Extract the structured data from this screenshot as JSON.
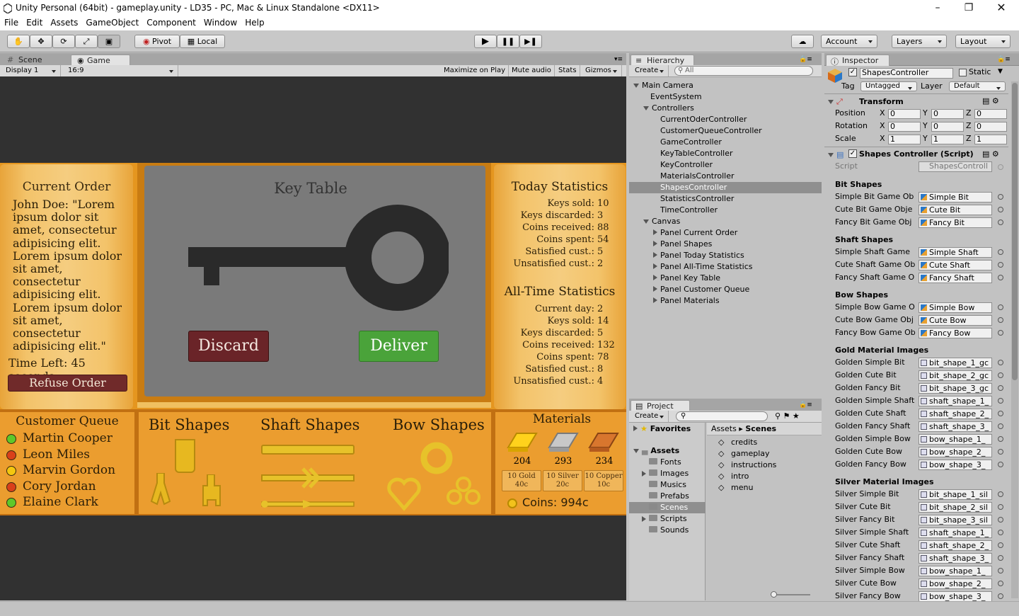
{
  "window": {
    "title": "Unity Personal (64bit) - gameplay.unity - LD35 - PC, Mac & Linux Standalone <DX11>"
  },
  "menu": [
    "File",
    "Edit",
    "Assets",
    "GameObject",
    "Component",
    "Window",
    "Help"
  ],
  "toolbar": {
    "pivot": "Pivot",
    "local": "Local",
    "account": "Account",
    "layers": "Layers",
    "layout": "Layout"
  },
  "tabs": {
    "scene": "Scene",
    "game": "Game",
    "hierarchy": "Hierarchy",
    "inspector": "Inspector",
    "project": "Project"
  },
  "gamebar": {
    "display": "Display 1",
    "aspect": "16:9",
    "maximize": "Maximize on Play",
    "mute": "Mute audio",
    "stats": "Stats",
    "gizmos": "Gizmos"
  },
  "game": {
    "current_order": {
      "title": "Current Order",
      "text": "John Doe: \"Lorem ipsum dolor sit amet, consectetur adipisicing elit. Lorem ipsum dolor sit amet, consectetur adipisicing elit. Lorem ipsum dolor sit amet, consectetur adipisicing elit.\"",
      "time_left": "Time Left: 45 seconds",
      "refuse": "Refuse Order"
    },
    "key_table": {
      "title": "Key Table",
      "discard": "Discard",
      "deliver": "Deliver"
    },
    "today": {
      "title": "Today Statistics",
      "rows": [
        [
          "Keys sold:",
          "10"
        ],
        [
          "Keys discarded:",
          "3"
        ],
        [
          "Coins received:",
          "88"
        ],
        [
          "Coins spent:",
          "54"
        ],
        [
          "Satisfied cust.:",
          "5"
        ],
        [
          "Unsatisfied cust.:",
          "2"
        ]
      ]
    },
    "alltime": {
      "title": "All-Time Statistics",
      "rows": [
        [
          "Current day:",
          "2"
        ],
        [
          "Keys sold:",
          "14"
        ],
        [
          "Keys discarded:",
          "5"
        ],
        [
          "Coins received:",
          "132"
        ],
        [
          "Coins spent:",
          "78"
        ],
        [
          "Satisfied cust.:",
          "8"
        ],
        [
          "Unsatisfied cust.:",
          "4"
        ]
      ]
    },
    "queue": {
      "title": "Customer Queue",
      "customers": [
        {
          "name": "Martin Cooper",
          "status": "#5ec82a"
        },
        {
          "name": "Leon Miles",
          "status": "#d9401a"
        },
        {
          "name": "Marvin Gordon",
          "status": "#f4c70f"
        },
        {
          "name": "Cory Jordan",
          "status": "#d9401a"
        },
        {
          "name": "Elaine Clark",
          "status": "#5ec82a"
        }
      ]
    },
    "shapes": {
      "bit": "Bit Shapes",
      "shaft": "Shaft Shapes",
      "bow": "Bow Shapes"
    },
    "materials": {
      "title": "Materials",
      "counts": [
        "204",
        "293",
        "234"
      ],
      "buy": [
        [
          "10 Gold",
          "40c"
        ],
        [
          "10 Silver",
          "20c"
        ],
        [
          "10 Copper",
          "10c"
        ]
      ],
      "coins": "Coins: 994c"
    }
  },
  "hierarchy": {
    "create": "Create",
    "search_placeholder": "All",
    "items": [
      {
        "label": "Main Camera",
        "depth": 0,
        "arrow": "open"
      },
      {
        "label": "EventSystem",
        "depth": 1,
        "arrow": "none"
      },
      {
        "label": "Controllers",
        "depth": 1,
        "arrow": "open"
      },
      {
        "label": "CurrentOderController",
        "depth": 2,
        "arrow": "none"
      },
      {
        "label": "CustomerQueueController",
        "depth": 2,
        "arrow": "none"
      },
      {
        "label": "GameController",
        "depth": 2,
        "arrow": "none"
      },
      {
        "label": "KeyTableController",
        "depth": 2,
        "arrow": "none"
      },
      {
        "label": "KeyController",
        "depth": 2,
        "arrow": "none"
      },
      {
        "label": "MaterialsController",
        "depth": 2,
        "arrow": "none"
      },
      {
        "label": "ShapesController",
        "depth": 2,
        "arrow": "none",
        "selected": true
      },
      {
        "label": "StatisticsController",
        "depth": 2,
        "arrow": "none"
      },
      {
        "label": "TimeController",
        "depth": 2,
        "arrow": "none"
      },
      {
        "label": "Canvas",
        "depth": 1,
        "arrow": "open"
      },
      {
        "label": "Panel Current Order",
        "depth": 2,
        "arrow": "closed"
      },
      {
        "label": "Panel Shapes",
        "depth": 2,
        "arrow": "closed"
      },
      {
        "label": "Panel Today Statistics",
        "depth": 2,
        "arrow": "closed"
      },
      {
        "label": "Panel All-Time Statistics",
        "depth": 2,
        "arrow": "closed"
      },
      {
        "label": "Panel Key Table",
        "depth": 2,
        "arrow": "closed"
      },
      {
        "label": "Panel Customer Queue",
        "depth": 2,
        "arrow": "closed"
      },
      {
        "label": "Panel Materials",
        "depth": 2,
        "arrow": "closed"
      }
    ]
  },
  "project": {
    "create": "Create",
    "favorites": "Favorites",
    "assets": "Assets",
    "folders": [
      "Fonts",
      "Images",
      "Musics",
      "Prefabs",
      "Scenes",
      "Scripts",
      "Sounds"
    ],
    "breadcrumb": [
      "Assets",
      "Scenes"
    ],
    "scenes": [
      "credits",
      "gameplay",
      "instructions",
      "intro",
      "menu"
    ]
  },
  "inspector": {
    "object_name": "ShapesController",
    "static": "Static",
    "tag_label": "Tag",
    "tag": "Untagged",
    "layer_label": "Layer",
    "layer": "Default",
    "transform": {
      "title": "Transform",
      "rows": [
        [
          "Position",
          "0",
          "0",
          "0"
        ],
        [
          "Rotation",
          "0",
          "0",
          "0"
        ],
        [
          "Scale",
          "1",
          "1",
          "1"
        ]
      ]
    },
    "script_title": "Shapes Controller (Script)",
    "script_label": "Script",
    "script_value": "ShapesControll",
    "sections": [
      {
        "title": "Bit Shapes",
        "rows": [
          [
            "Simple Bit Game Ob",
            "Simple Bit"
          ],
          [
            "Cute Bit Game Obje",
            "Cute Bit"
          ],
          [
            "Fancy Bit Game Obj",
            "Fancy Bit"
          ]
        ]
      },
      {
        "title": "Shaft Shapes",
        "rows": [
          [
            "Simple Shaft Game",
            "Simple Shaft"
          ],
          [
            "Cute Shaft Game Ob",
            "Cute Shaft"
          ],
          [
            "Fancy Shaft Game O",
            "Fancy Shaft"
          ]
        ]
      },
      {
        "title": "Bow Shapes",
        "rows": [
          [
            "Simple Bow Game O",
            "Simple Bow"
          ],
          [
            "Cute Bow Game Obj",
            "Cute Bow"
          ],
          [
            "Fancy Bow Game Ob",
            "Fancy Bow"
          ]
        ]
      },
      {
        "title": "Gold Material Images",
        "rows": [
          [
            "Golden Simple Bit",
            "bit_shape_1_gc"
          ],
          [
            "Golden Cute Bit",
            "bit_shape_2_gc"
          ],
          [
            "Golden Fancy Bit",
            "bit_shape_3_gc"
          ],
          [
            "Golden Simple Shaft",
            "shaft_shape_1_"
          ],
          [
            "Golden Cute Shaft",
            "shaft_shape_2_"
          ],
          [
            "Golden Fancy Shaft",
            "shaft_shape_3_"
          ],
          [
            "Golden Simple Bow",
            "bow_shape_1_"
          ],
          [
            "Golden Cute Bow",
            "bow_shape_2_"
          ],
          [
            "Golden Fancy Bow",
            "bow_shape_3_"
          ]
        ]
      },
      {
        "title": "Silver Material Images",
        "rows": [
          [
            "Silver Simple Bit",
            "bit_shape_1_sil"
          ],
          [
            "Silver Cute Bit",
            "bit_shape_2_sil"
          ],
          [
            "Silver Fancy Bit",
            "bit_shape_3_sil"
          ],
          [
            "Silver Simple Shaft",
            "shaft_shape_1_"
          ],
          [
            "Silver Cute Shaft",
            "shaft_shape_2_"
          ],
          [
            "Silver Fancy Shaft",
            "shaft_shape_3_"
          ],
          [
            "Silver Simple Bow",
            "bow_shape_1_"
          ],
          [
            "Silver Cute Bow",
            "bow_shape_2_"
          ],
          [
            "Silver Fancy Bow",
            "bow_shape_3_"
          ]
        ]
      }
    ]
  }
}
